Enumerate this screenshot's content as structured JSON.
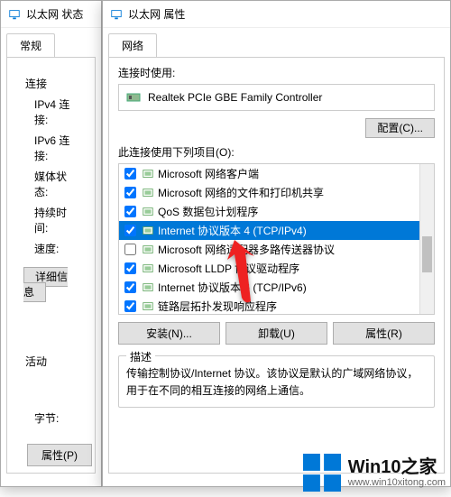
{
  "status_win": {
    "title": "以太网 状态",
    "tab": "常规",
    "conn_label": "连接",
    "ipv4_label": "IPv4 连接:",
    "ipv6_label": "IPv6 连接:",
    "media_label": "媒体状态:",
    "duration_label": "持续时间:",
    "speed_label": "速度:",
    "details_btn": "详细信息",
    "activity_label": "活动",
    "bytes_label": "字节:",
    "props_btn": "属性(P)"
  },
  "props_win": {
    "title": "以太网 属性",
    "tab": "网络",
    "connect_using": "连接时使用:",
    "adapter": "Realtek PCIe GBE Family Controller",
    "configure_btn": "配置(C)...",
    "items_label": "此连接使用下列项目(O):",
    "items": [
      {
        "checked": true,
        "label": "Microsoft 网络客户端"
      },
      {
        "checked": true,
        "label": "Microsoft 网络的文件和打印机共享"
      },
      {
        "checked": true,
        "label": "QoS 数据包计划程序"
      },
      {
        "checked": true,
        "label": "Internet 协议版本 4 (TCP/IPv4)",
        "selected": true
      },
      {
        "checked": false,
        "label": "Microsoft 网络适配器多路传送器协议"
      },
      {
        "checked": true,
        "label": "Microsoft LLDP 协议驱动程序"
      },
      {
        "checked": true,
        "label": "Internet 协议版本 6 (TCP/IPv6)"
      },
      {
        "checked": true,
        "label": "链路层拓扑发现响应程序"
      }
    ],
    "install_btn": "安装(N)...",
    "uninstall_btn": "卸载(U)",
    "props_btn": "属性(R)",
    "desc_title": "描述",
    "desc_text": "传输控制协议/Internet 协议。该协议是默认的广域网络协议，用于在不同的相互连接的网络上通信。"
  },
  "watermark": {
    "brand": "Win10之家",
    "url": "www.win10xitong.com"
  }
}
